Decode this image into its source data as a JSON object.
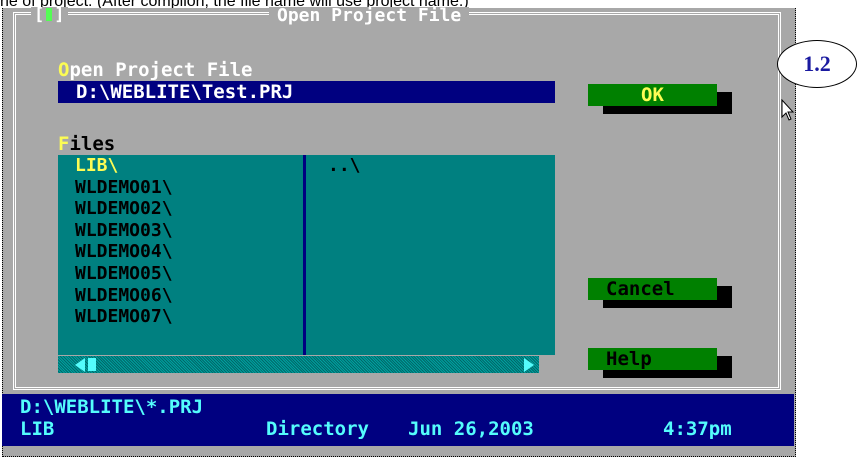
{
  "caption": "ne of project. (After compilon, the file name will use project name.)",
  "window": {
    "title": "Open Project File",
    "close_box": "[",
    "close_box_end": "]"
  },
  "open_field": {
    "label_hotkey": "O",
    "label_rest": "pen Project File",
    "value": "D:\\WEBLITE\\Test.PRJ"
  },
  "files": {
    "label_hotkey": "F",
    "label_rest": "iles",
    "column1": [
      "LIB\\",
      "WLDEMO01\\",
      "WLDEMO02\\",
      "WLDEMO03\\",
      "WLDEMO04\\",
      "WLDEMO05\\",
      "WLDEMO06\\",
      "WLDEMO07\\"
    ],
    "column2": [
      "..\\"
    ],
    "selected_index": 0
  },
  "buttons": {
    "ok": "OK",
    "cancel_hotkey": "C",
    "cancel_rest": "ancel",
    "help_hotkey": "H",
    "help_rest": "elp"
  },
  "status": {
    "path": "D:\\WEBLITE\\*.PRJ",
    "name": "LIB",
    "type": "Directory",
    "date": "Jun 26,2003",
    "time": "4:37pm"
  },
  "annotation": "1.2",
  "colors": {
    "dialog_bg": "#a8a8a8",
    "input_bg": "#000080",
    "list_bg": "#008080",
    "button_bg": "#008000",
    "highlight": "#fcfc54",
    "status_text": "#54fcfc"
  }
}
